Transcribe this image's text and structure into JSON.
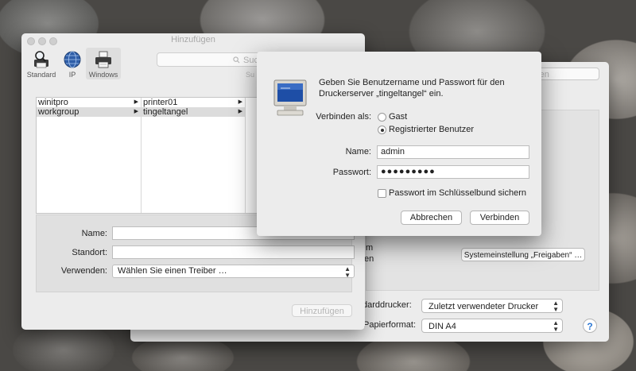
{
  "back_window": {
    "search_placeholder": "chen",
    "fragment_m": "m",
    "fragment_en": "en",
    "sharing_button": "Systemeinstellung „Freigaben“ …",
    "default_printer_label": "darddrucker:",
    "default_printer_value": "Zuletzt verwendeter Drucker",
    "paper_label": "Papierformat:",
    "paper_value": "DIN A4",
    "help": "?"
  },
  "front_window": {
    "title": "Hinzufügen",
    "toolbar": [
      {
        "label": "Standard",
        "icon": "magnifier-printer-icon"
      },
      {
        "label": "IP",
        "icon": "globe-icon"
      },
      {
        "label": "Windows",
        "icon": "printer-icon"
      }
    ],
    "search_placeholder": "Suc",
    "search_sub": "Su",
    "browser": {
      "col1": [
        "winitpro",
        "workgroup"
      ],
      "col2": [
        "printer01",
        "tingeltangel"
      ]
    },
    "form": {
      "name_label": "Name:",
      "location_label": "Standort:",
      "use_label": "Verwenden:",
      "use_value": "Wählen Sie einen Treiber …"
    },
    "add_button": "Hinzufügen"
  },
  "auth_dialog": {
    "message": "Geben Sie Benutzername und Passwort für den Druckerserver „tingeltangel“ ein.",
    "connect_as_label": "Verbinden als:",
    "guest": "Gast",
    "registered": "Registrierter Benutzer",
    "name_label": "Name:",
    "name_value": "admin",
    "password_label": "Passwort:",
    "password_value": "●●●●●●●●●",
    "keychain": "Passwort im Schlüsselbund sichern",
    "cancel": "Abbrechen",
    "connect": "Verbinden"
  }
}
